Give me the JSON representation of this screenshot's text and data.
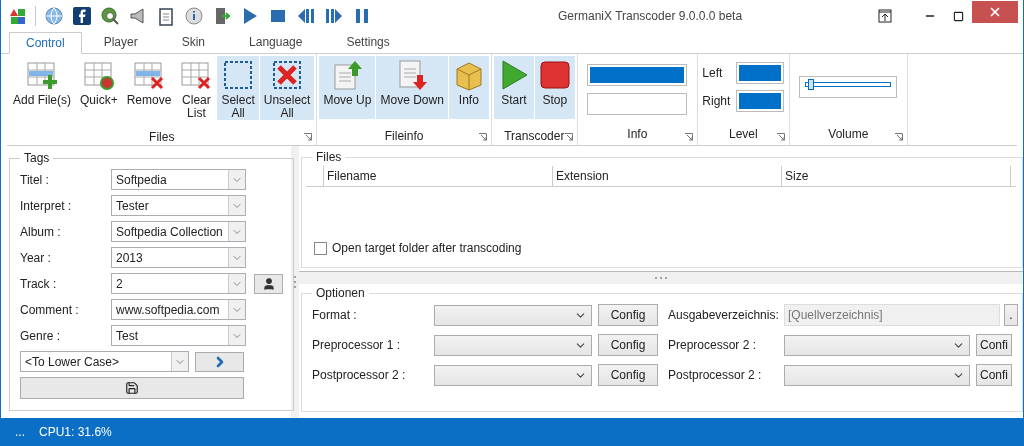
{
  "window": {
    "title": "GermaniX Transcoder 9.0.0.0 beta"
  },
  "tabs": [
    {
      "label": "Control",
      "selected": true
    },
    {
      "label": "Player",
      "selected": false
    },
    {
      "label": "Skin",
      "selected": false
    },
    {
      "label": "Language",
      "selected": false
    },
    {
      "label": "Settings",
      "selected": false
    }
  ],
  "ribbon": {
    "groups": [
      {
        "label": "Files",
        "buttons": [
          {
            "kind": "add",
            "label": "Add File(s)",
            "highlighted": false
          },
          {
            "kind": "quick",
            "label": "Quick+",
            "highlighted": false
          },
          {
            "kind": "remove",
            "label": "Remove",
            "highlighted": false
          },
          {
            "kind": "clear",
            "label": "Clear\nList",
            "highlighted": false
          },
          {
            "kind": "select",
            "label": "Select\nAll",
            "highlighted": true
          },
          {
            "kind": "unselect",
            "label": "Unselect\nAll",
            "highlighted": true
          }
        ]
      },
      {
        "label": "Fileinfo",
        "buttons": [
          {
            "kind": "moveup",
            "label": "Move Up",
            "highlighted": true
          },
          {
            "kind": "movedown",
            "label": "Move Down",
            "highlighted": true
          },
          {
            "kind": "info",
            "label": "Info",
            "highlighted": true
          }
        ]
      },
      {
        "label": "Transcoder",
        "buttons": [
          {
            "kind": "start",
            "label": "Start",
            "highlighted": true
          },
          {
            "kind": "stop",
            "label": "Stop",
            "highlighted": true
          }
        ]
      }
    ],
    "info": {
      "label": "Info",
      "bar": {
        "level": 1
      }
    },
    "level": {
      "label": "Level",
      "channels": [
        {
          "name": "Left",
          "level": 1
        },
        {
          "name": "Right",
          "level": 1
        }
      ]
    },
    "volume": {
      "label": "Volume",
      "level": 0.02
    }
  },
  "tags": {
    "title": "Tags",
    "fields": [
      {
        "label": "Titel :",
        "value": "Softpedia"
      },
      {
        "label": "Interpret :",
        "value": "Tester"
      },
      {
        "label": "Album :",
        "value": "Softpedia Collection"
      },
      {
        "label": "Year :",
        "value": "2013"
      },
      {
        "label": "Track :",
        "value": "2"
      },
      {
        "label": "Comment :",
        "value": "www.softpedia.com"
      },
      {
        "label": "Genre :",
        "value": "Test"
      }
    ],
    "case": {
      "value": "<To Lower Case>"
    }
  },
  "files": {
    "title": "Files",
    "columns": [
      "Filename",
      "Extension",
      "Size"
    ],
    "open_folder": {
      "label": "Open target folder after transcoding",
      "checked": false
    }
  },
  "options": {
    "title": "Optionen",
    "left": [
      {
        "label": "Format :",
        "button": "Config"
      },
      {
        "label": "Preprocessor 1 :",
        "button": "Config"
      },
      {
        "label": "Postprocessor 2 :",
        "button": "Config"
      }
    ],
    "output": {
      "label": "Ausgabeverzeichnis:",
      "value": "[Quellverzeichnis]",
      "button": "."
    },
    "right": [
      {
        "label": "Preprocessor 2 :",
        "button": "Confi"
      },
      {
        "label": "Postprocessor 2 :",
        "button": "Confi"
      }
    ]
  },
  "status_bar": {
    "menu": "...",
    "cpu": "CPU1: 31.6%"
  }
}
